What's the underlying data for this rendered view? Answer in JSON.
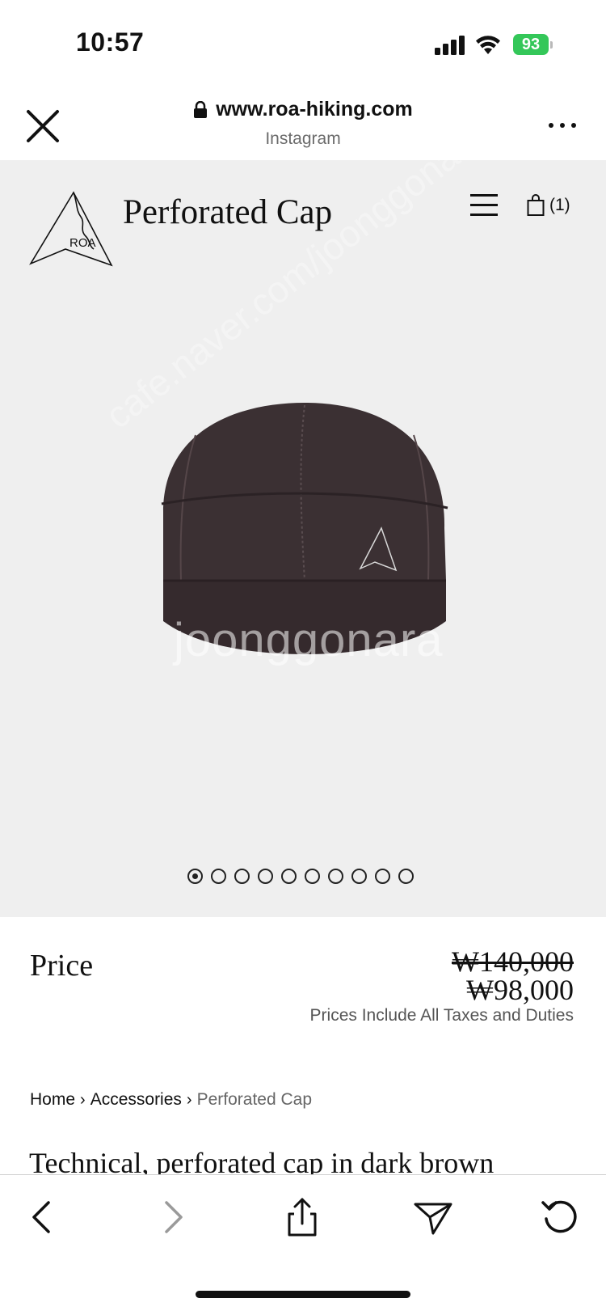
{
  "status_bar": {
    "time": "10:57",
    "battery_level": "93",
    "battery_color": "#34c759",
    "icons": [
      "signal-icon",
      "wifi-icon",
      "battery-charging-icon"
    ]
  },
  "browser": {
    "url": "www.roa-hiking.com",
    "source": "Instagram",
    "icons": [
      "close-icon",
      "lock-icon",
      "more-icon"
    ]
  },
  "site": {
    "brand": "ROA",
    "title": "Perforated Cap",
    "cart_count": "(1)",
    "icons": [
      "logo-icon",
      "menu-icon",
      "shopping-bag-icon"
    ]
  },
  "gallery": {
    "image_alt": "dark brown cap",
    "watermark": "joonggonara",
    "watermark_diag": "cafe.naver.com/joonggonara",
    "slides": 10,
    "active_slide": 1
  },
  "price": {
    "label": "Price",
    "original": "₩140,000",
    "sale": "₩98,000",
    "note": "Prices Include All Taxes and Duties"
  },
  "breadcrumb": {
    "home": "Home",
    "category": "Accessories",
    "current": "Perforated Cap",
    "separator": "›"
  },
  "description": "Technical, perforated cap in dark brown",
  "toolbar": {
    "icons": [
      "back-icon",
      "forward-icon",
      "share-icon",
      "send-icon",
      "reload-icon"
    ]
  }
}
